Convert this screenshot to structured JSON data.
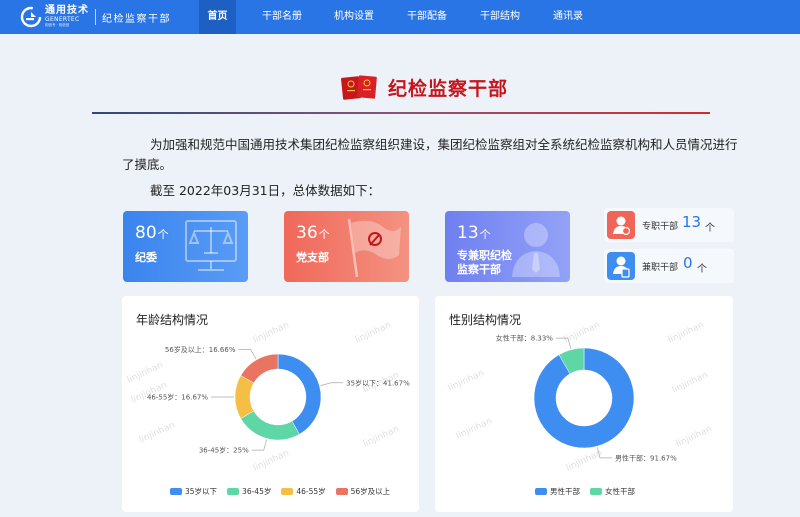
{
  "nav": {
    "logo_cn": "通用技术",
    "logo_en": "GENERTEC",
    "logo_sub": "相信专 · 相信信",
    "logo_dept": "纪检监察干部",
    "items": [
      {
        "label": "首页",
        "active": true
      },
      {
        "label": "干部名册",
        "active": false
      },
      {
        "label": "机构设置",
        "active": false
      },
      {
        "label": "干部配备",
        "active": false
      },
      {
        "label": "干部结构",
        "active": false
      },
      {
        "label": "通讯录",
        "active": false
      }
    ]
  },
  "page_title": "纪检监察干部",
  "intro": "为加强和规范中国通用技术集团纪检监察组织建设，集团纪检监察组对全系统纪检监察机构和人员情况进行了摸底。",
  "as_of": "截至 2022年03月31日，总体数据如下：",
  "stats": [
    {
      "num": "80",
      "unit": "个",
      "label": "纪委",
      "color_from": "#3a84ee",
      "color_to": "#5a9cf6"
    },
    {
      "num": "36",
      "unit": "个",
      "label": "党支部",
      "color_from": "#f0685a",
      "color_to": "#f49281"
    },
    {
      "num": "13",
      "unit": "个",
      "label1": "专兼职纪检",
      "label2": "监察干部",
      "color_from": "#6f7ff0",
      "color_to": "#93a2f7"
    }
  ],
  "mini_stats": [
    {
      "label": "专职干部",
      "num": "13",
      "unit": "个",
      "color": "#ef6557"
    },
    {
      "label": "兼职干部",
      "num": "0",
      "unit": "个",
      "color": "#3d8ef0"
    }
  ],
  "watermark": "linjinhan",
  "chart_data": [
    {
      "type": "pie",
      "title": "年龄结构情况",
      "categories": [
        "35岁以下",
        "36-45岁",
        "46-55岁",
        "56岁及以上"
      ],
      "values": [
        41.67,
        25,
        16.67,
        16.66
      ],
      "slice_labels": [
        "35岁以下：41.67%",
        "36-45岁：25%",
        "46-55岁：16.67%",
        "56岁及以上：16.66%"
      ],
      "colors": [
        "#3d8ef0",
        "#5fd6a6",
        "#f5be44",
        "#e97462"
      ],
      "legend": "bottom"
    },
    {
      "type": "pie",
      "title": "性别结构情况",
      "categories": [
        "男性干部",
        "女性干部"
      ],
      "values": [
        91.67,
        8.33
      ],
      "slice_labels": [
        "男性干部：91.67%",
        "女性干部：8.33%"
      ],
      "colors": [
        "#3d8ef0",
        "#5fd6a6"
      ],
      "legend": "bottom"
    }
  ]
}
